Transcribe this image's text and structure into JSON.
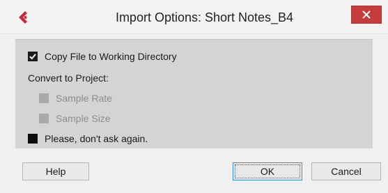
{
  "window": {
    "title": "Import Options: Short Notes_B4",
    "logo_icon": "cubase-logo-icon",
    "close_icon": "close-icon",
    "accent_color": "#c43c3c"
  },
  "options": {
    "copy_file": {
      "label": "Copy File to Working Directory",
      "checked": true,
      "enabled": true
    },
    "convert_heading": "Convert to Project:",
    "sample_rate": {
      "label": "Sample Rate",
      "checked": false,
      "enabled": false
    },
    "sample_size": {
      "label": "Sample Size",
      "checked": false,
      "enabled": false
    },
    "dont_ask": {
      "label": "Please, don't ask again.",
      "checked": false,
      "enabled": true
    }
  },
  "buttons": {
    "help": "Help",
    "ok": "OK",
    "cancel": "Cancel"
  }
}
